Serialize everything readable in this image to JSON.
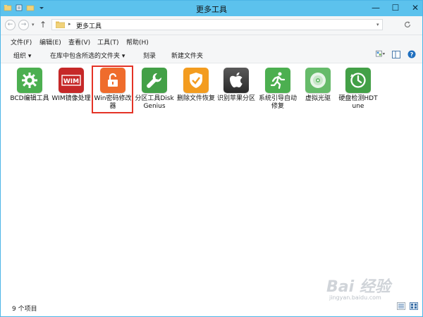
{
  "window": {
    "title": "更多工具",
    "controls": {
      "minimize": "—",
      "maximize": "☐",
      "close": "✕"
    }
  },
  "address": {
    "separator": "▸",
    "path": "更多工具",
    "refresh_icon": "refresh-icon"
  },
  "nav": {
    "back": "←",
    "forward": "→",
    "dropdown": "▾",
    "up": "↑"
  },
  "menu": [
    "文件(F)",
    "编辑(E)",
    "查看(V)",
    "工具(T)",
    "帮助(H)"
  ],
  "toolbar": {
    "organize": "组织 ▾",
    "include": "在库中包含所选的文件夹 ▾",
    "burn": "刻录",
    "new_folder": "新建文件夹"
  },
  "files": [
    {
      "label": "BCD编辑工具",
      "icon": "gear-icon",
      "color": "#4caf50"
    },
    {
      "label": "WIM镜像处理",
      "icon": "wim-icon",
      "color": "#c62828"
    },
    {
      "label": "Win密码修改器",
      "icon": "unlock-icon",
      "color": "#ef6c2c"
    },
    {
      "label": "分区工具DiskGenius",
      "icon": "wrench-icon",
      "color": "#43a047"
    },
    {
      "label": "删除文件恢复",
      "icon": "shield-check-icon",
      "color": "#f39c1f"
    },
    {
      "label": "识别苹果分区",
      "icon": "apple-icon",
      "color": "#3a3a3a"
    },
    {
      "label": "系统引导自动修复",
      "icon": "runner-icon",
      "color": "#4caf50"
    },
    {
      "label": "虚拟光驱",
      "icon": "disc-icon",
      "color": "#66bb6a"
    },
    {
      "label": "硬盘检测HDTune",
      "icon": "clock-check-icon",
      "color": "#43a047"
    }
  ],
  "status": {
    "count": "9 个项目"
  },
  "watermark": {
    "logo": "Bai 经验",
    "url": "jingyan.baidu.com"
  }
}
